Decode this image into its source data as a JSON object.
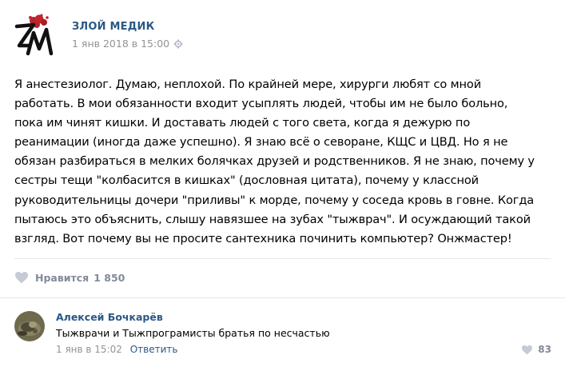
{
  "post": {
    "author": "ЗЛОЙ МЕДИК",
    "date": "1 янв 2018 в 15:00",
    "text_lines": [
      "Я анестезиолог. Думаю, неплохой. По крайней мере, хирурги любят со мной",
      "работать. В мои обязанности входит усыплять людей, чтобы им не было больно,",
      "пока им чинят кишки. И доставать людей с того света, когда я дежурю по",
      "реанимации (иногда даже успешно). Я знаю всё о севоране, КЩС и ЦВД. Но я не",
      "обязан разбираться в мелких болячках друзей и родственников. Я не знаю, почему у",
      "сестры тещи \"колбасится в кишках\" (дословная цитата), почему у классной",
      "руководительницы дочери \"приливы\" к морде, почему у соседа кровь в говне. Когда",
      "пытаюсь это объяснить, слышу навязшее на зубах \"тыжврач\". И осуждающий такой",
      "взгляд. Вот почему вы не просите сантехника починить компьютер? Онжмастер!"
    ],
    "like_label": "Нравится",
    "like_count": "1 850"
  },
  "comment": {
    "author": "Алексей Бочкарёв",
    "text": "Тыжврачи и Тыжпрограмисты братья по несчастью",
    "date": "1 янв в 15:02",
    "reply_label": "Ответить",
    "like_count": "83"
  },
  "icons": {
    "logo": "zm-logo",
    "settings": "gear-icon",
    "like": "heart-icon"
  },
  "colors": {
    "link": "#2a5885",
    "muted": "#939393",
    "like_gray": "#828a99",
    "divider": "#e7e8ec",
    "logo_red": "#c0262d"
  }
}
